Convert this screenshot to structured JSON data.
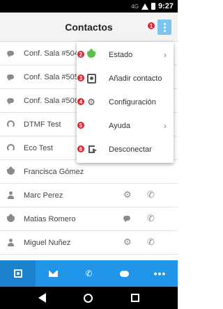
{
  "status_bar": {
    "network": "4G",
    "time": "9:27"
  },
  "app_bar": {
    "title": "Contactos",
    "menu_icon": "more-vert-icon"
  },
  "contacts": [
    {
      "name": "Conf. Sala #504",
      "icon": "chat-bubble-icon"
    },
    {
      "name": "Conf. Sala #505",
      "icon": "chat-bubble-icon"
    },
    {
      "name": "Conf. Sala #506",
      "icon": "chat-bubble-icon"
    },
    {
      "name": "DTMF Test",
      "icon": "headset-icon"
    },
    {
      "name": "Eco Test",
      "icon": "headset-icon"
    },
    {
      "name": "Francisca Gómez",
      "icon": "lotus-icon"
    },
    {
      "name": "Marc Perez",
      "icon": "person-icon",
      "actions": [
        "gear-icon",
        "phone-icon"
      ]
    },
    {
      "name": "Matias Romero",
      "icon": "lotus-icon",
      "actions": [
        "chat-icon",
        "phone-icon"
      ]
    },
    {
      "name": "Miguel Nuñez",
      "icon": "person-icon",
      "actions": [
        "gear-icon",
        "phone-icon"
      ]
    }
  ],
  "menu": {
    "items": [
      {
        "badge": "2",
        "label": "Estado",
        "icon": "status-lotus-icon",
        "submenu": true
      },
      {
        "badge": "3",
        "label": "Añadir contacto",
        "icon": "add-contact-icon",
        "submenu": false
      },
      {
        "badge": "4",
        "label": "Configuración",
        "icon": "gears-icon",
        "submenu": false
      },
      {
        "badge": "5",
        "label": "Ayuda",
        "icon": "",
        "submenu": true
      },
      {
        "badge": "6",
        "label": "Desconectar",
        "icon": "logout-icon",
        "submenu": false
      }
    ],
    "button_badge": "1"
  },
  "bottom_nav": [
    {
      "name": "contacts-tab",
      "icon": "contacts-icon",
      "active": true
    },
    {
      "name": "messages-tab",
      "icon": "mail-icon",
      "active": false
    },
    {
      "name": "calls-tab",
      "icon": "phone-icon",
      "active": false
    },
    {
      "name": "chat-tab",
      "icon": "chat-icon",
      "active": false
    },
    {
      "name": "more-tab",
      "icon": "more-icon",
      "active": false
    }
  ],
  "colors": {
    "accent": "#2196e8",
    "badge": "#e0232c",
    "status_green": "#58c04a",
    "menu_button": "#7ec3ef"
  },
  "glyphs": {
    "chevron": "›",
    "gear": "⚙",
    "phone": "✆",
    "chat": "💬",
    "dots": "•••"
  }
}
